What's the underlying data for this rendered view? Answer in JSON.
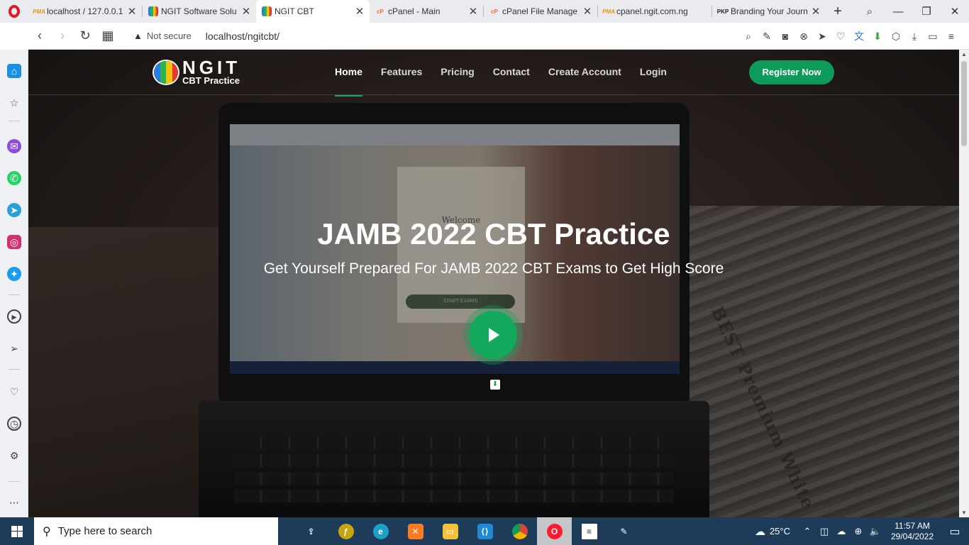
{
  "browser": {
    "tabs": [
      {
        "title": "localhost / 127.0.0.1",
        "favicon": "phpmyadmin-icon",
        "fav_text": "PMA",
        "active": false
      },
      {
        "title": "NGIT Software Solu",
        "favicon": "ngit-icon",
        "fav_text": "",
        "active": false
      },
      {
        "title": "NGIT CBT",
        "favicon": "ngit-icon",
        "fav_text": "",
        "active": true
      },
      {
        "title": "cPanel - Main",
        "favicon": "cpanel-icon",
        "fav_text": "cP",
        "active": false
      },
      {
        "title": "cPanel File Manage",
        "favicon": "cpanel-icon",
        "fav_text": "cP",
        "active": false
      },
      {
        "title": "cpanel.ngit.com.ng",
        "favicon": "phpmyadmin-icon",
        "fav_text": "PMA",
        "active": false
      },
      {
        "title": "Branding Your Journ",
        "favicon": "pkp-icon",
        "fav_text": "PKP",
        "active": false
      }
    ],
    "close_glyph": "✕",
    "new_tab_glyph": "+",
    "window_controls": {
      "search": "⌕",
      "minimize": "—",
      "restore": "❐",
      "close": "✕"
    },
    "security_label": "Not secure",
    "url": "localhost/ngitcbt/"
  },
  "site": {
    "logo_name": "NGIT",
    "logo_sub": "CBT Practice",
    "nav": [
      "Home",
      "Features",
      "Pricing",
      "Contact",
      "Create Account",
      "Login"
    ],
    "register_label": "Register Now",
    "hero_title": "JAMB 2022 CBT Practice",
    "hero_subtitle": "Get Yourself Prepared For JAMB 2022 CBT Exams to Get High Score",
    "colors": {
      "accent": "#0e9a5b",
      "overlay": "#2e2522"
    }
  },
  "taskbar": {
    "search_placeholder": "Type here to search",
    "apps": [
      "file-upload-icon",
      "filezilla-icon",
      "edge-icon",
      "xampp-icon",
      "file-explorer-icon",
      "vscode-icon",
      "chrome-icon",
      "opera-icon",
      "notepad-icon",
      "paint-icon"
    ],
    "temperature": "25°C",
    "time": "11:57 AM",
    "date": "29/04/2022"
  }
}
